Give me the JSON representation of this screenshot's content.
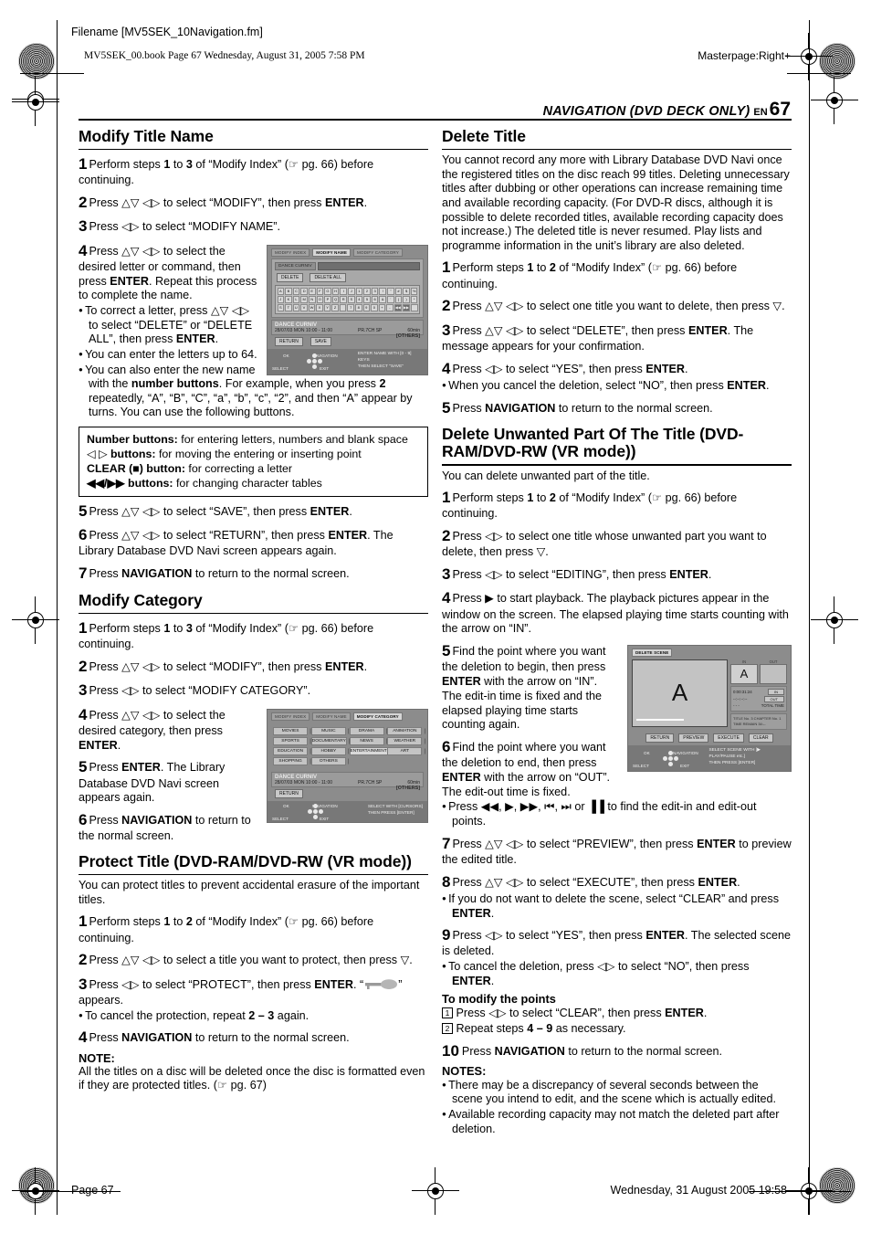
{
  "header": {
    "filename": "Filename [MV5SEK_10Navigation.fm]",
    "bookline": "MV5SEK_00.book  Page 67  Wednesday, August 31, 2005  7:58 PM",
    "masterpage": "Masterpage:Right+",
    "running_head": "NAVIGATION (DVD DECK ONLY)",
    "lang_code": "EN",
    "page_number": "67"
  },
  "footer": {
    "page_label": "Page 67",
    "date": "Wednesday, 31 August 2005  19:58"
  },
  "left_column": {
    "modify_title_name": {
      "heading": "Modify Title Name",
      "steps": [
        {
          "n": "1",
          "html": "Perform steps <b>1</b> to <b>3</b> of “Modify Index” (☞ pg. 66) before continuing."
        },
        {
          "n": "2",
          "html": "Press △▽ ◁▷ to select “MODIFY”, then press <b>ENTER</b>."
        },
        {
          "n": "3",
          "html": "Press ◁▷ to select “MODIFY NAME”."
        },
        {
          "n": "4",
          "html": "Press △▽ ◁▷ to select the desired letter or command, then press <b>ENTER</b>. Repeat this process to complete the name."
        }
      ],
      "bullets": [
        "To correct a letter, press △▽ ◁▷ to select “DELETE” or “DELETE ALL”, then press <b>ENTER</b>.",
        "You can enter the letters up to 64.",
        "You can also enter the new name with the <b>number buttons</b>. For example, when you press <b>2</b> repeatedly, “A”, “B”, “C”, “a”, “b”, “c”, “2”, and then “A” appear by turns. You can use the following buttons."
      ],
      "number_box": [
        "<b>Number buttons:</b> for entering letters, numbers and blank space",
        "◁ ▷ <b>buttons:</b> for moving the entering or inserting point",
        "<b>CLEAR (■) button:</b> for correcting a letter",
        "<b>◀◀/▶▶ buttons:</b> for changing character tables"
      ],
      "steps_after": [
        {
          "n": "5",
          "html": "Press △▽ ◁▷ to select “SAVE”, then press <b>ENTER</b>."
        },
        {
          "n": "6",
          "html": "Press △▽ ◁▷ to select “RETURN”, then press <b>ENTER</b>. The Library Database DVD Navi screen appears again."
        },
        {
          "n": "7",
          "html": "Press <b>NAVIGATION</b> to return to the normal screen."
        }
      ]
    },
    "modify_category": {
      "heading": "Modify Category",
      "steps": [
        {
          "n": "1",
          "html": "Perform steps <b>1</b> to <b>3</b> of “Modify Index” (☞ pg. 66) before continuing."
        },
        {
          "n": "2",
          "html": "Press △▽ ◁▷ to select “MODIFY”, then press <b>ENTER</b>."
        },
        {
          "n": "3",
          "html": "Press ◁▷ to select “MODIFY CATEGORY”."
        },
        {
          "n": "4",
          "html": "Press △▽ ◁▷ to select the desired category, then press <b>ENTER</b>."
        },
        {
          "n": "5",
          "html": "Press <b>ENTER</b>. The Library Database DVD Navi screen appears again."
        },
        {
          "n": "6",
          "html": "Press <b>NAVIGATION</b> to return to the normal screen."
        }
      ]
    },
    "protect_title": {
      "heading": "Protect Title (DVD-RAM/DVD-RW (VR mode))",
      "intro": "You can protect titles to prevent accidental erasure of the important titles.",
      "steps": [
        {
          "n": "1",
          "html": "Perform steps <b>1</b> to <b>2</b> of “Modify Index” (☞ pg. 66) before continuing."
        },
        {
          "n": "2",
          "html": "Press △▽ ◁▷ to select a title you want to protect, then press ▽."
        },
        {
          "n": "3",
          "html": "Press ◁▷ to select “PROTECT”, then press <b>ENTER</b>. “<span class=\"keyicon\"></span>” appears."
        }
      ],
      "bullet": "To cancel the protection, repeat <b>2 – 3</b> again.",
      "step4": {
        "n": "4",
        "html": "Press <b>NAVIGATION</b> to return to the normal screen."
      },
      "note_heading": "NOTE:",
      "note": "All the titles on a disc will be deleted once the disc is formatted even if they are protected titles. (☞ pg. 67)"
    }
  },
  "right_column": {
    "delete_title": {
      "heading": "Delete Title",
      "intro": "You cannot record any more with Library Database DVD Navi once the registered titles on the disc reach 99 titles. Deleting unnecessary titles after dubbing or other operations can increase remaining time and available recording capacity. (For DVD-R discs, although it is possible to delete recorded titles, available recording capacity does not increase.) The deleted title is never resumed. Play lists and programme information in the unit’s library are also deleted.",
      "steps": [
        {
          "n": "1",
          "html": "Perform steps <b>1</b> to <b>2</b> of “Modify Index” (☞ pg. 66) before continuing."
        },
        {
          "n": "2",
          "html": "Press △▽ ◁▷ to select one title you want to delete, then press ▽."
        },
        {
          "n": "3",
          "html": "Press △▽ ◁▷ to select “DELETE”, then press <b>ENTER</b>. The message appears for your confirmation."
        },
        {
          "n": "4",
          "html": "Press ◁▷ to select “YES”, then press <b>ENTER</b>."
        }
      ],
      "bullet": "When you cancel the deletion, select “NO”, then press <b>ENTER</b>.",
      "step5": {
        "n": "5",
        "html": "Press <b>NAVIGATION</b> to return to the normal screen."
      }
    },
    "delete_unwanted": {
      "heading": "Delete Unwanted Part Of The Title (DVD-RAM/DVD-RW (VR mode))",
      "intro": "You can delete unwanted part of the title.",
      "steps": [
        {
          "n": "1",
          "html": "Perform steps <b>1</b> to <b>2</b> of “Modify Index” (☞ pg. 66) before continuing."
        },
        {
          "n": "2",
          "html": "Press ◁▷ to select one title whose unwanted part you want to delete, then press ▽."
        },
        {
          "n": "3",
          "html": "Press ◁▷ to select “EDITING”, then press <b>ENTER</b>."
        },
        {
          "n": "4",
          "html": "Press ▶ to start playback. The playback pictures appear in the window on the screen. The elapsed playing time starts counting with the arrow on “IN”."
        },
        {
          "n": "5",
          "html": "Find the point where you want the deletion to begin, then press <b>ENTER</b> with the arrow on “IN”. The edit-in time is fixed and the elapsed playing time starts counting again."
        },
        {
          "n": "6",
          "html": "Find the point where you want the deletion to end, then press <b>ENTER</b> with the arrow on “OUT”. The edit-out time is fixed."
        }
      ],
      "bullet6": "Press ◀◀, ▶, ▶▶, ⏮, ⏭ or ▐▐ to find the edit-in and edit-out points.",
      "steps2": [
        {
          "n": "7",
          "html": "Press △▽ ◁▷ to select “PREVIEW”, then press <b>ENTER</b> to preview the edited title."
        },
        {
          "n": "8",
          "html": "Press △▽ ◁▷ to select “EXECUTE”, then press <b>ENTER</b>."
        }
      ],
      "bullet8": "If you do not want to delete the scene, select “CLEAR” and press <b>ENTER</b>.",
      "step9": {
        "n": "9",
        "html": "Press ◁▷ to select “YES”, then press <b>ENTER</b>. The selected scene is deleted."
      },
      "bullet9": "To cancel the deletion, press ◁▷ to select “NO”, then press <b>ENTER</b>.",
      "modify_points_heading": "To modify the points",
      "modify_points": [
        {
          "n": "1",
          "html": "Press ◁▷ to select “CLEAR”, then press <b>ENTER</b>."
        },
        {
          "n": "2",
          "html": "Repeat steps <b>4 – 9</b> as necessary."
        }
      ],
      "step10": {
        "n": "10",
        "html": "Press <b>NAVIGATION</b> to return to the normal screen."
      },
      "notes_heading": "NOTES:",
      "notes": [
        "There may be a discrepancy of several seconds between the scene you intend to edit, and the scene which is actually edited.",
        "Available recording capacity may not match the deleted part after deletion."
      ]
    }
  },
  "osd_modify_name": {
    "tabs": [
      "MODIFY INDEX",
      "MODIFY NAME",
      "MODIFY CATEGORY"
    ],
    "active_tab": "MODIFY NAME",
    "title_chip": "DANCE CURNIV",
    "buttons": [
      "DELETE",
      "DELETE ALL"
    ],
    "char_rows": [
      [
        "A",
        "B",
        "C",
        "D",
        "E",
        "F",
        "G",
        "H",
        "I",
        "J",
        "1",
        "2",
        "3",
        "!",
        "\"",
        "#",
        "$",
        "%"
      ],
      [
        "J",
        "K",
        "L",
        "M",
        "N",
        "O",
        "P",
        "Q",
        "R",
        "S",
        "4",
        "5",
        "6",
        "&",
        "'",
        "(",
        ")",
        "*"
      ],
      [
        "S",
        "T",
        "U",
        "V",
        "W",
        "X",
        "Y",
        "Z",
        " ",
        "7",
        "8",
        "9",
        "0",
        "+",
        "-",
        "◀◀",
        "▶▶",
        ""
      ]
    ],
    "info_title": "DANCE CURNIV",
    "info_date": "28/07/03 MON 10:00 - 11:00",
    "info_channel": "PR.7CH SP",
    "info_length": "60min",
    "info_category": "[OTHERS]",
    "bottom_buttons": [
      "RETURN",
      "SAVE"
    ],
    "guide_ok": "OK",
    "guide_nav": "NAVIGATION",
    "guide_select": "SELECT",
    "guide_exit": "EXIT",
    "guide_right1": "ENTER NAME WITH [0 - 9] KEYS",
    "guide_right2": "THEN SELECT \"SAVE\""
  },
  "osd_modify_category": {
    "tabs": [
      "MODIFY INDEX",
      "MODIFY NAME",
      "MODIFY CATEGORY"
    ],
    "active_tab": "MODIFY CATEGORY",
    "categories": [
      "MOVIES",
      "MUSIC",
      "DRAMA",
      "ANIMATION",
      "SPORTS",
      "DOCUMENTARY",
      "NEWS",
      "WEATHER",
      "EDUCATION",
      "HOBBY",
      "ENTERTAINMENT",
      "ART",
      "SHOPPING",
      "OTHERS"
    ],
    "selected_category": "ENTERTAINMENT",
    "info_title": "DANCE CURNIV",
    "info_date": "28/07/03 MON 10:00 - 11:00",
    "info_channel": "PR.7CH SP",
    "info_length": "60min",
    "info_category": "[OTHERS]",
    "bottom_buttons": [
      "RETURN"
    ],
    "guide_ok": "OK",
    "guide_nav": "NAVIGATION",
    "guide_select": "SELECT",
    "guide_exit": "EXIT",
    "guide_right1": "SELECT WITH [CURSORS]",
    "guide_right2": "THEN PRESS [ENTER]"
  },
  "osd_delete_scene": {
    "tab": "DELETE SCENE",
    "preview_letter": "A",
    "thumb_letter": "A",
    "col_in": "IN",
    "col_out": "OUT",
    "timecode": "0:00:31:24",
    "row_in": "IN",
    "row_out": "OUT",
    "row_total": "TOTAL TIME",
    "time_dashes": "--:--:--:--",
    "time_zeros": "-  -  -",
    "msg1": "TITLE No. 3 CHAPTER No. 1",
    "msg2": "TIME REMAIN 34:--",
    "buttons": [
      "RETURN",
      "PREVIEW",
      "EXECUTE",
      "CLEAR"
    ],
    "guide_ok": "OK",
    "guide_nav": "NAVIGATION",
    "guide_select": "SELECT",
    "guide_exit": "EXIT",
    "guide_right1": "SELECT SCENE WITH [▶ PLAY/PAUSE etc.]",
    "guide_right2": "THEN PRESS [ENTER]"
  }
}
